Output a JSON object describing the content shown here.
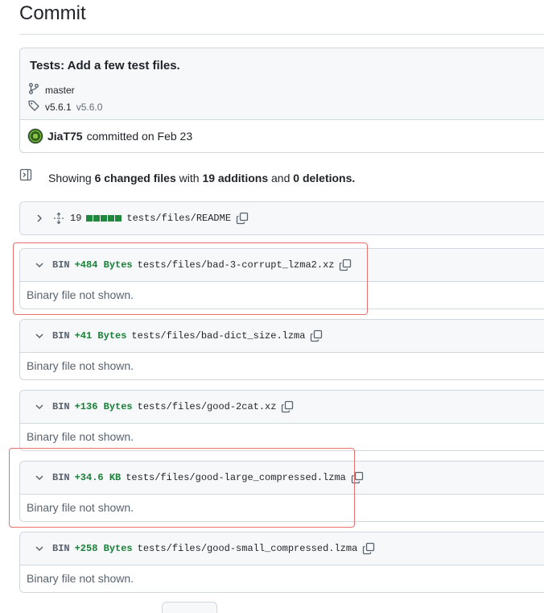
{
  "page": {
    "title": "Commit"
  },
  "commit": {
    "message": "Tests: Add a few test files.",
    "branch": "master",
    "tags": [
      "v5.6.1",
      "v5.6.0"
    ],
    "author": "JiaT75",
    "committed_text": "committed on Feb 23"
  },
  "summary": {
    "showing": "Showing",
    "changed_files": "6 changed files",
    "with": "with",
    "additions": "19 additions",
    "and": "and",
    "deletions": "0 deletions."
  },
  "files": [
    {
      "kind": "text",
      "count": "19",
      "path": "tests/files/README",
      "diffstat_blocks": 5
    },
    {
      "kind": "binary",
      "label": "BIN",
      "size": "+484 Bytes",
      "path": "tests/files/bad-3-corrupt_lzma2.xz",
      "body": "Binary file not shown."
    },
    {
      "kind": "binary",
      "label": "BIN",
      "size": "+41 Bytes",
      "path": "tests/files/bad-dict_size.lzma",
      "body": "Binary file not shown."
    },
    {
      "kind": "binary",
      "label": "BIN",
      "size": "+136 Bytes",
      "path": "tests/files/good-2cat.xz",
      "body": "Binary file not shown."
    },
    {
      "kind": "binary",
      "label": "BIN",
      "size": "+34.6 KB",
      "path": "tests/files/good-large_compressed.lzma",
      "body": "Binary file not shown."
    },
    {
      "kind": "binary",
      "label": "BIN",
      "size": "+258 Bytes",
      "path": "tests/files/good-small_compressed.lzma",
      "body": "Binary file not shown."
    }
  ],
  "colors": {
    "addition_green": "#1a7f37",
    "diffstat_green": "#1f883d",
    "annotation_red": "#e8716f",
    "border": "#d0d7de"
  },
  "icons": {
    "branch": "git-branch-icon",
    "tag": "tag-icon",
    "toggle_tree": "sidebar-expand-icon",
    "chevron_right": "chevron-right-icon",
    "chevron_down": "chevron-down-icon",
    "expand": "unfold-icon",
    "copy": "copy-icon"
  }
}
